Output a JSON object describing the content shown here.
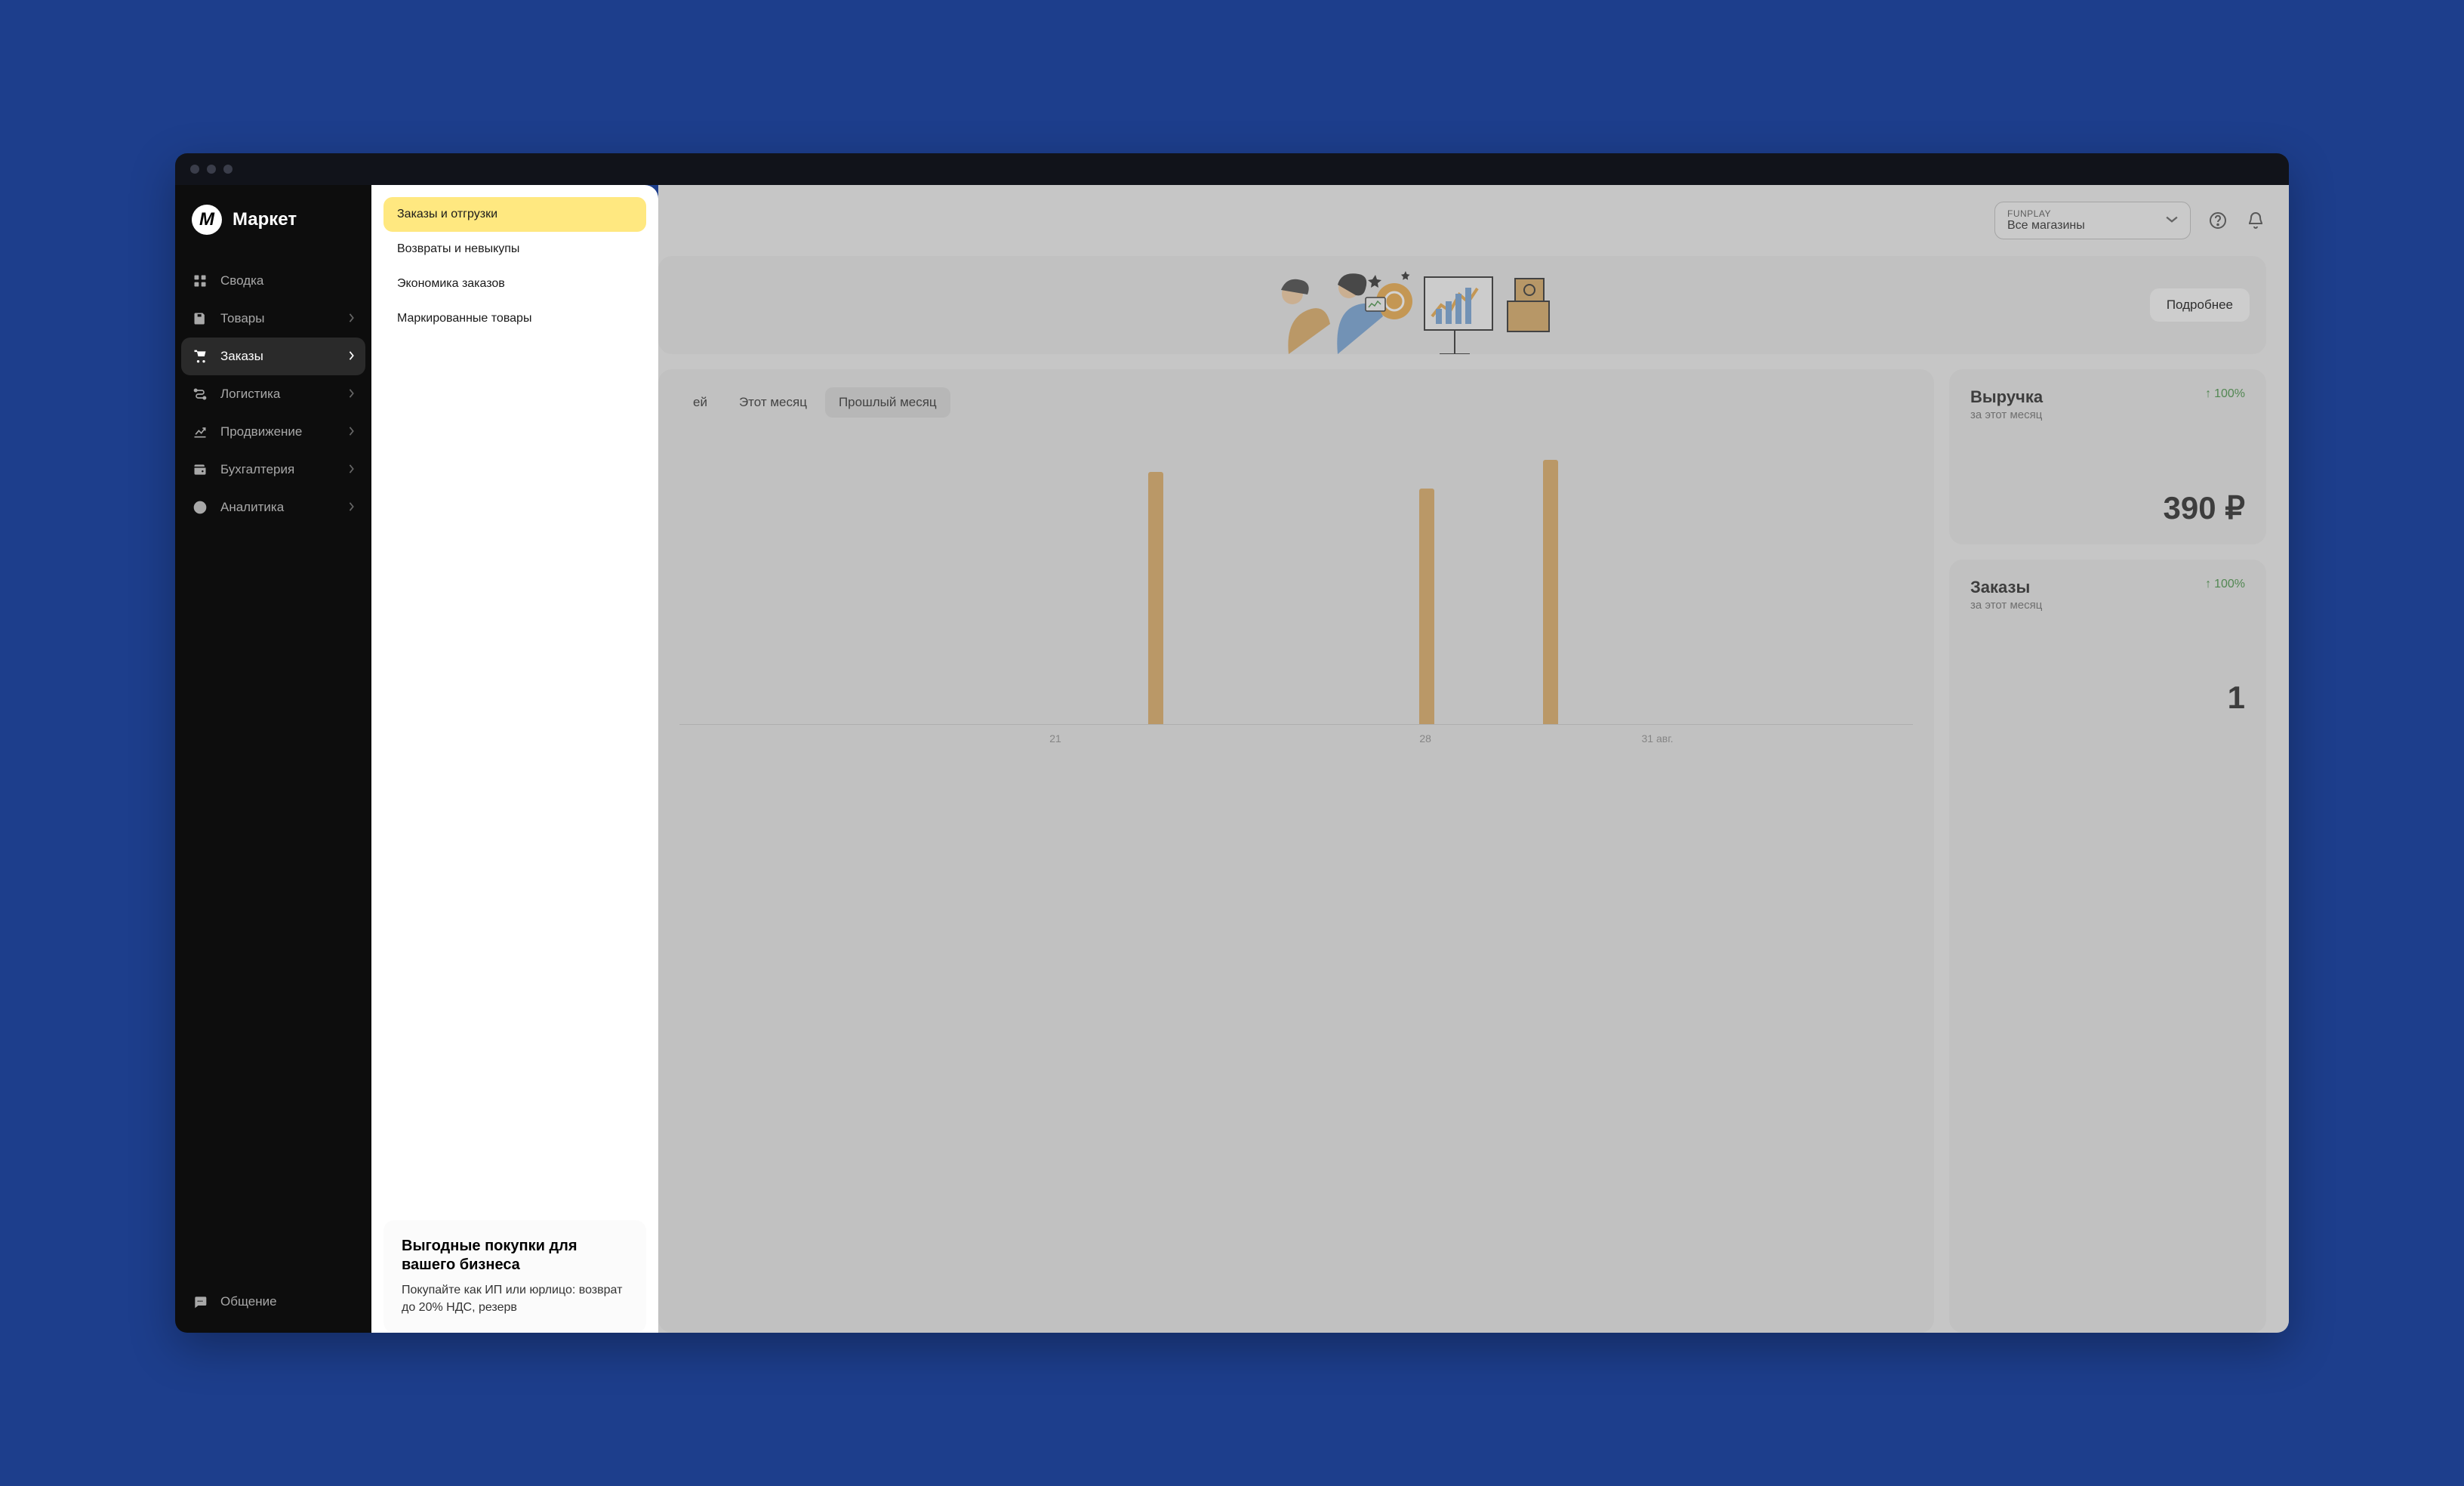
{
  "logo": {
    "text": "Маркет"
  },
  "sidebar": {
    "items": [
      {
        "label": "Сводка",
        "hasChevron": false
      },
      {
        "label": "Товары",
        "hasChevron": true
      },
      {
        "label": "Заказы",
        "hasChevron": true,
        "active": true
      },
      {
        "label": "Логистика",
        "hasChevron": true
      },
      {
        "label": "Продвижение",
        "hasChevron": true
      },
      {
        "label": "Бухгалтерия",
        "hasChevron": true
      },
      {
        "label": "Аналитика",
        "hasChevron": true
      }
    ],
    "bottom": {
      "label": "Общение"
    }
  },
  "submenu": {
    "items": [
      {
        "label": "Заказы и отгрузки",
        "selected": true
      },
      {
        "label": "Возвраты и невыкупы"
      },
      {
        "label": "Экономика заказов"
      },
      {
        "label": "Маркированные товары"
      }
    ]
  },
  "promo": {
    "title": "Выгодные покупки для вашего бизнеса",
    "text": "Покупайте как ИП или юрлицо: возврат до 20% НДС, резерв"
  },
  "topbar": {
    "shopLabel": "FUNPLAY",
    "shopValue": "Все магазины"
  },
  "banner": {
    "button": "Подробнее"
  },
  "tabs": [
    {
      "label": "ей"
    },
    {
      "label": "Этот месяц"
    },
    {
      "label": "Прошлый месяц",
      "active": true
    }
  ],
  "revenueCard": {
    "title": "Выручка",
    "subtitle": "за этот месяц",
    "pct": "100%",
    "value": "390 ₽"
  },
  "ordersCard": {
    "title": "Заказы",
    "subtitle": "за этот месяц",
    "pct": "100%",
    "value": "1"
  },
  "chart_data": {
    "type": "bar",
    "categories": [
      "21",
      "28",
      "31 авг."
    ],
    "visible_bars": [
      {
        "x_pos": 0.38,
        "height": 0.88
      },
      {
        "x_pos": 0.6,
        "height": 0.82
      },
      {
        "x_pos": 0.7,
        "height": 0.92
      }
    ],
    "axis_ticks": [
      {
        "label": "21",
        "pos": 0.3
      },
      {
        "label": "28",
        "pos": 0.6
      },
      {
        "label": "31 авг.",
        "pos": 0.78
      }
    ]
  }
}
